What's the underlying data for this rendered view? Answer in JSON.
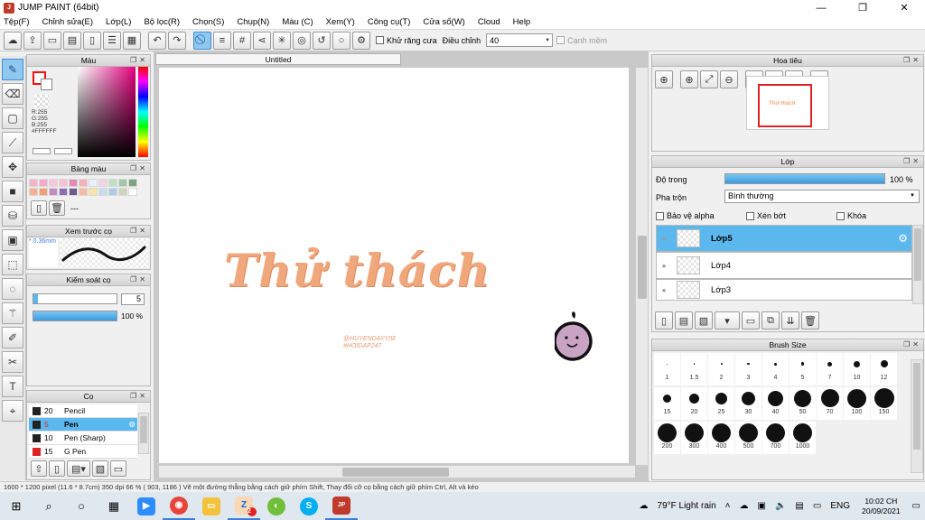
{
  "window": {
    "title": "JUMP PAINT (64bit)",
    "min": "—",
    "restore": "❐",
    "close": "✕"
  },
  "menu": [
    "Tệp(F)",
    "Chỉnh sửa(E)",
    "Lớp(L)",
    "Bộ lọc(R)",
    "Chọn(S)",
    "Chụp(N)",
    "Màu (C)",
    "Xem(Y)",
    "Công cụ(T)",
    "Cửa sổ(W)",
    "Cloud",
    "Help"
  ],
  "toolbar": {
    "antialias_label": "Khử răng cưa",
    "adjust_label": "Điều chỉnh",
    "adjust_value": "40",
    "edge_label": "Cạnh mềm"
  },
  "color_panel": {
    "title": "Màu",
    "r": "R:255",
    "g": "G:255",
    "b": "B:255",
    "hex": "#FFFFFF",
    "fg_color": "#ffffff",
    "bg_color": "#ffffff"
  },
  "swatch_panel": {
    "title": "Bảng màu",
    "extra": "---",
    "colors": [
      "#f4b3c6",
      "#f7a8c9",
      "#f9c7dc",
      "#f7c1d3",
      "#e58ab4",
      "#f5b0b8",
      "#e9f2f7",
      "#f3d3e6",
      "#bfe3c2",
      "#9fc9a5",
      "#7ea47f",
      "#f6b08e",
      "#f19f72",
      "#c58bc1",
      "#8e6bb2",
      "#6e5a8c",
      "#f7b9a4",
      "#f9e3a7",
      "#c7dcef",
      "#aecbe8",
      "#cbd7b6",
      "#ffffff"
    ]
  },
  "brush_preview_panel": {
    "title": "Xem trước cọ",
    "size": "* 0.36mm"
  },
  "brush_control_panel": {
    "title": "Kiểm soát cọ",
    "size_value": "5",
    "opacity": "100 %"
  },
  "brush_list_panel": {
    "title": "Cọ",
    "items": [
      {
        "size": "20",
        "name": "Pencil",
        "color": "#222222"
      },
      {
        "size": "5",
        "name": "Pen",
        "color": "#222222"
      },
      {
        "size": "10",
        "name": "Pen (Sharp)",
        "color": "#222222"
      },
      {
        "size": "15",
        "name": "G Pen",
        "color": "#e02222"
      }
    ]
  },
  "canvas": {
    "tab_title": "Untitled",
    "art_main": "Thử thách",
    "art_handle1": "@HUYENDAYY08",
    "art_handle2": "#HOIDAP247"
  },
  "navigator": {
    "title": "Hoa tiêu",
    "mini": "Thử thách"
  },
  "layer_panel": {
    "title": "Lớp",
    "opacity_label": "Độ trong",
    "opacity_value": "100 %",
    "blend_label": "Pha trộn",
    "blend_value": "Bình thường",
    "protect_alpha": "Bảo vệ alpha",
    "clip": "Xén bớt",
    "lock": "Khóa",
    "layers": [
      "Lớp5",
      "Lớp4",
      "Lớp3"
    ]
  },
  "brush_size_panel": {
    "title": "Brush Size",
    "sizes": [
      "1",
      "1.5",
      "2",
      "3",
      "4",
      "5",
      "7",
      "10",
      "12",
      "15",
      "20",
      "25",
      "30",
      "40",
      "50",
      "70",
      "100",
      "150",
      "200",
      "300",
      "400",
      "500",
      "700",
      "1000"
    ]
  },
  "status": {
    "text": "1600 * 1200 pixel   (11.6 * 8.7cm)   350 dpi   66 %   ( 903, 1186 )   Vẽ một đường thẳng bằng cách giữ phím Shift, Thay đổi cỡ cọ bằng cách giữ phím Ctrl, Alt và kéo"
  },
  "taskbar": {
    "weather": "79°F  Light rain",
    "lang": "ENG",
    "time": "10:02 CH",
    "date": "20/09/2021",
    "badge": "2"
  }
}
